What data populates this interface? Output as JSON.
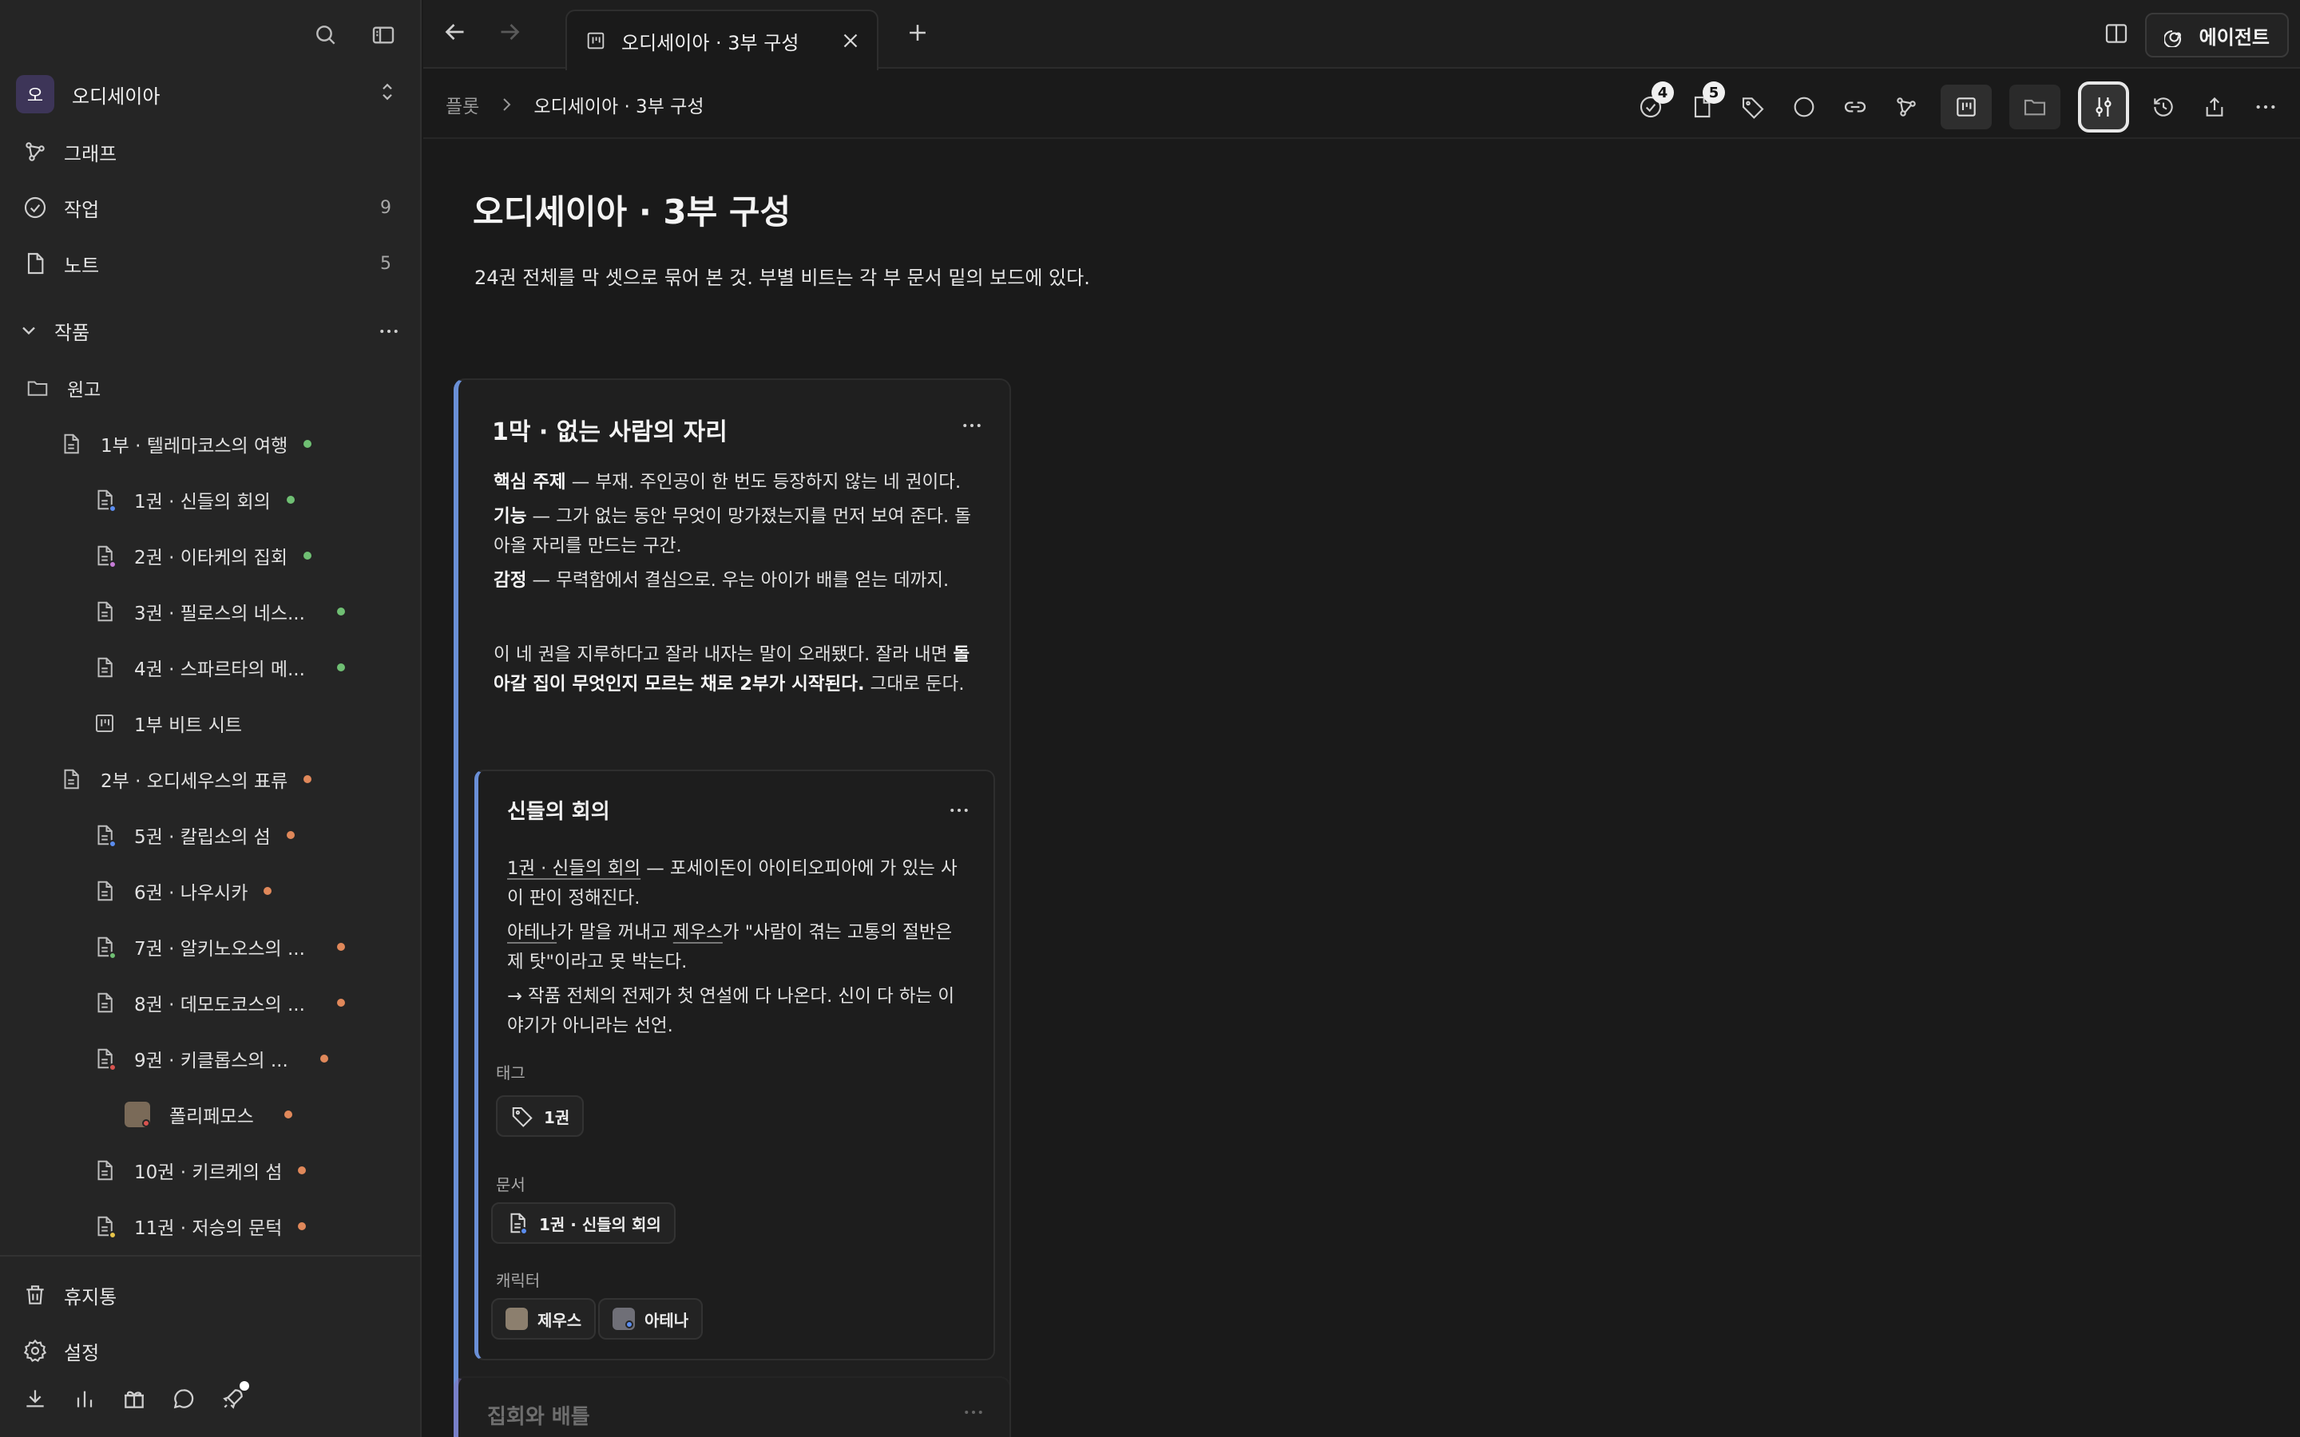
{
  "workspace": {
    "avatar_letter": "오",
    "name": "오디세이아"
  },
  "nav": [
    {
      "label": "그래프",
      "count": "",
      "icon": "graph-icon"
    },
    {
      "label": "작업",
      "count": "9",
      "icon": "task-check-icon"
    },
    {
      "label": "노트",
      "count": "5",
      "icon": "note-icon"
    }
  ],
  "section": {
    "label": "작품"
  },
  "tree": [
    {
      "label": "원고",
      "icon": "folder-icon",
      "dot": ""
    },
    {
      "label": "1부 · 텔레마코스의 여행",
      "icon": "doc-icon",
      "dot": "#6fbf73"
    },
    {
      "label": "1권 · 신들의 회의",
      "icon": "doc-icon",
      "dot": "#6fbf73",
      "mini": "#5b8def"
    },
    {
      "label": "2권 · 이타케의 집회",
      "icon": "doc-icon",
      "dot": "#6fbf73",
      "mini": "#c77dd7"
    },
    {
      "label": "3권 · 필로스의 네스...",
      "icon": "doc-icon",
      "dot": "#6fbf73"
    },
    {
      "label": "4권 · 스파르타의 메...",
      "icon": "doc-icon",
      "dot": "#6fbf73"
    },
    {
      "label": "1부 비트 시트",
      "icon": "board-icon",
      "dot": ""
    },
    {
      "label": "2부 · 오디세우스의 표류",
      "icon": "doc-icon",
      "dot": "#e0885a"
    },
    {
      "label": "5권 · 칼립소의 섬",
      "icon": "doc-icon",
      "dot": "#e0885a",
      "mini": "#5b8def"
    },
    {
      "label": "6권 · 나우시카",
      "icon": "doc-icon",
      "dot": "#e0885a"
    },
    {
      "label": "7권 · 알키노오스의 ...",
      "icon": "doc-icon",
      "dot": "#e0885a",
      "mini": "#6fbf73"
    },
    {
      "label": "8권 · 데모도코스의 ...",
      "icon": "doc-icon",
      "dot": "#e0885a"
    },
    {
      "label": "9권 · 키클롭스의 ...",
      "icon": "doc-icon",
      "dot": "#e0885a",
      "mini": "#d9534f"
    },
    {
      "label": "폴리페모스",
      "icon": "character-avatar",
      "dot": "#e0885a"
    },
    {
      "label": "10권 · 키르케의 섬",
      "icon": "doc-icon",
      "dot": "#e0885a"
    },
    {
      "label": "11권 · 저승의 문턱",
      "icon": "doc-icon",
      "dot": "#e0885a",
      "mini": "#e8c54a"
    }
  ],
  "footer_nav": [
    {
      "label": "휴지통",
      "icon": "trash-icon"
    },
    {
      "label": "설정",
      "icon": "gear-icon"
    }
  ],
  "tab": {
    "title": "오디세이아 · 3부 구성"
  },
  "agent_button": {
    "label": "에이전트"
  },
  "breadcrumb": {
    "root": "플롯",
    "current": "오디세이아 · 3부 구성"
  },
  "toolbar": {
    "tasks_badge": "4",
    "notes_badge": "5"
  },
  "page": {
    "title": "오디세이아 · 3부 구성",
    "description": "24권 전체를 막 셋으로 묶어 본 것. 부별 비트는 각 부 문서 밑의 보드에 있다."
  },
  "card": {
    "title": "1막 · 없는 사람의 자리",
    "theme_label": "핵심 주제",
    "theme_text": " — 부재. 주인공이 한 번도 등장하지 않는 네 권이다.",
    "function_label": "기능",
    "function_text": " — 그가 없는 동안 무엇이 망가졌는지를 먼저 보여 준다. 돌아올 자리를 만드는 구간.",
    "emotion_label": "감정",
    "emotion_text": " — 무력함에서 결심으로. 우는 아이가 배를 얻는 데까지.",
    "note_pre": "이 네 권을 지루하다고 잘라 내자는 말이 오래됐다. 잘라 내면 ",
    "note_bold": "돌아갈 집이 무엇인지 모르는 채로 2부가 시작된다.",
    "note_post": " 그대로 둔다."
  },
  "subcard": {
    "title": "신들의 회의",
    "line1_link": "1권 · 신들의 회의",
    "line1_text": " — 포세이돈이 아이티오피아에 가 있는 사이 판이 정해진다.",
    "line2_link1": "아테나",
    "line2_mid": "가 말을 꺼내고 ",
    "line2_link2": "제우스",
    "line2_text": "가 \"사람이 겪는 고통의 절반은 제 탓\"이라고 못 박는다.",
    "line3": "→ 작품 전체의 전제가 첫 연설에 다 나온다. 신이 다 하는 이야기가 아니라는 선언.",
    "tags_label": "태그",
    "tag": "1권",
    "docs_label": "문서",
    "doc": "1권 · 신들의 회의",
    "chars_label": "캐릭터",
    "char1": "제우스",
    "char2": "아테나"
  },
  "card2": {
    "title": "집회와 배틀"
  },
  "colors": {
    "accent_blue": "#6a8fd6",
    "status_green": "#6fbf73",
    "status_orange": "#e0885a"
  }
}
